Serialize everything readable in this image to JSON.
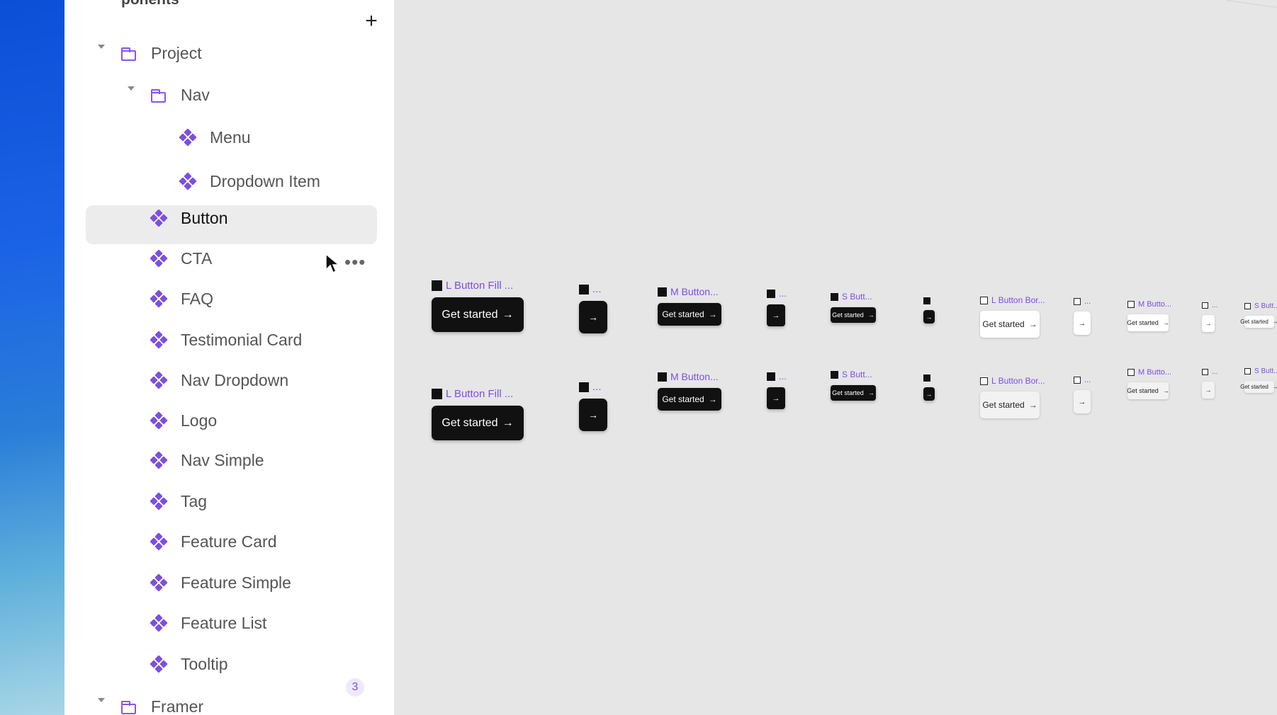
{
  "panel": {
    "heading": "ponents",
    "add_icon": "plus-icon",
    "more_icon": "more-horizontal-icon",
    "badge_count": "3",
    "tree": [
      {
        "label": "Project",
        "kind": "folder",
        "expanded": true
      },
      {
        "label": "Nav",
        "kind": "folder",
        "expanded": true
      },
      {
        "label": "Menu",
        "kind": "component"
      },
      {
        "label": "Dropdown Item",
        "kind": "component"
      },
      {
        "label": "Button",
        "kind": "component",
        "selected": true
      },
      {
        "label": "CTA",
        "kind": "component",
        "hovered": true
      },
      {
        "label": "FAQ",
        "kind": "component"
      },
      {
        "label": "Testimonial Card",
        "kind": "component"
      },
      {
        "label": "Nav Dropdown",
        "kind": "component"
      },
      {
        "label": "Logo",
        "kind": "component"
      },
      {
        "label": "Nav Simple",
        "kind": "component"
      },
      {
        "label": "Tag",
        "kind": "component"
      },
      {
        "label": "Feature Card",
        "kind": "component"
      },
      {
        "label": "Feature Simple",
        "kind": "component"
      },
      {
        "label": "Feature List",
        "kind": "component"
      },
      {
        "label": "Tooltip",
        "kind": "component"
      },
      {
        "label": "Framer",
        "kind": "folder",
        "expanded": true
      }
    ]
  },
  "canvas": {
    "button_text": "Get started",
    "arrow": "→",
    "variants": [
      {
        "label": "L Button Fill ...",
        "style": "fill",
        "has_text": true
      },
      {
        "label": "...",
        "style": "fill",
        "has_text": false
      },
      {
        "label": "M Button...",
        "style": "fill",
        "has_text": true
      },
      {
        "label": "...",
        "style": "fill",
        "has_text": false
      },
      {
        "label": "S Butt...",
        "style": "fill",
        "has_text": true
      },
      {
        "label": "",
        "style": "fill",
        "has_text": false
      },
      {
        "label": "L Button Bor...",
        "style": "outline",
        "has_text": true
      },
      {
        "label": "...",
        "style": "outline",
        "has_text": false
      },
      {
        "label": "M Butto...",
        "style": "outline",
        "has_text": true
      },
      {
        "label": "...",
        "style": "outline",
        "has_text": false
      },
      {
        "label": "S Butt...",
        "style": "outline",
        "has_text": true
      },
      {
        "label": "L Button Fill ...",
        "style": "fill",
        "has_text": true
      },
      {
        "label": "...",
        "style": "fill",
        "has_text": false
      },
      {
        "label": "M Button...",
        "style": "fill",
        "has_text": true
      },
      {
        "label": "...",
        "style": "fill",
        "has_text": false
      },
      {
        "label": "S Butt...",
        "style": "fill",
        "has_text": true
      },
      {
        "label": "",
        "style": "fill",
        "has_text": false
      },
      {
        "label": "L Button Bor...",
        "style": "outline-soft",
        "has_text": true
      },
      {
        "label": "...",
        "style": "outline-soft",
        "has_text": false
      },
      {
        "label": "M Butto...",
        "style": "outline-soft",
        "has_text": true
      },
      {
        "label": "...",
        "style": "outline-soft",
        "has_text": false
      },
      {
        "label": "S Butt...",
        "style": "outline-soft",
        "has_text": true
      }
    ]
  },
  "colors": {
    "accent": "#7c4ee4",
    "selected_row": "#ececec",
    "canvas_bg": "#e6e6e6"
  }
}
